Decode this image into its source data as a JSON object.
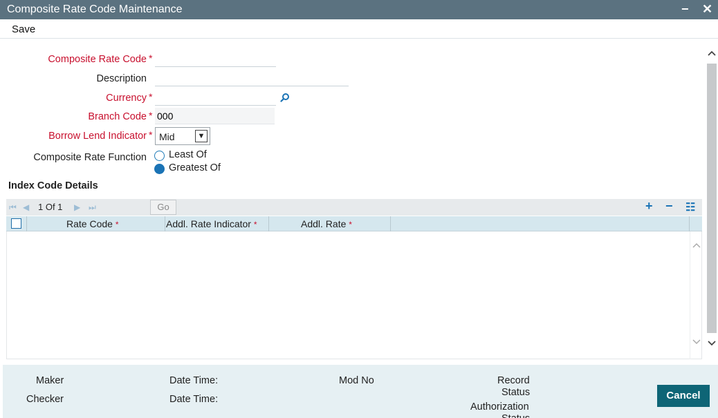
{
  "window": {
    "title": "Composite Rate Code Maintenance",
    "minimize_glyph": "−",
    "close_glyph": "✕"
  },
  "menu": {
    "save_label": "Save"
  },
  "form": {
    "composite_rate_code": {
      "label": "Composite Rate Code",
      "value": "",
      "required": true
    },
    "description": {
      "label": "Description",
      "value": ""
    },
    "currency": {
      "label": "Currency",
      "value": "",
      "required": true,
      "lookup_icon": "search-icon"
    },
    "branch_code": {
      "label": "Branch Code",
      "value": "000",
      "required": true
    },
    "borrow_lend_indicator": {
      "label": "Borrow Lend Indicator",
      "value": "Mid",
      "required": true
    },
    "composite_rate_function": {
      "label": "Composite Rate Function",
      "options": [
        {
          "label": "Least Of",
          "selected": false
        },
        {
          "label": "Greatest Of",
          "selected": true
        }
      ]
    },
    "required_marker": "*"
  },
  "index_code_details": {
    "title": "Index Code Details",
    "pager": {
      "text": "1 Of 1",
      "go_label": "Go"
    },
    "columns": [
      {
        "label": "Rate Code",
        "required": true
      },
      {
        "label": "Addl. Rate Indicator",
        "required": true
      },
      {
        "label": "Addl. Rate",
        "required": true
      }
    ],
    "rows": [],
    "toolbar": {
      "add": "+",
      "remove": "−",
      "list": "☷"
    }
  },
  "footer": {
    "maker_label": "Maker",
    "checker_label": "Checker",
    "date_time_label_1": "Date Time:",
    "date_time_label_2": "Date Time:",
    "mod_no_label": "Mod No",
    "record_label": "Record",
    "status_label_1": "Status",
    "authorization_label": "Authorization",
    "status_label_2": "Status",
    "cancel_label": "Cancel"
  },
  "colors": {
    "title_bar": "#5b7280",
    "required": "#c8102e",
    "accent": "#1a73b5",
    "cancel_button": "#0e6576",
    "footer_bg": "#e6f0f3",
    "grid_header": "#d5e7ee"
  }
}
